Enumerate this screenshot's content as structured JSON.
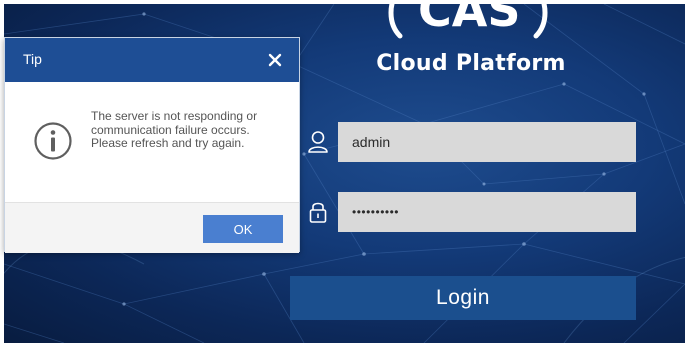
{
  "brand": {
    "logo_text": "CAS",
    "platform_name": "Cloud Platform"
  },
  "login_form": {
    "username_icon": "user-icon",
    "username_value": "admin",
    "password_icon": "lock-icon",
    "password_value": "••••••••••",
    "login_label": "Login"
  },
  "dialog": {
    "title": "Tip",
    "close_icon": "close-icon",
    "info_icon": "info-icon",
    "message": "The server is not responding or communication failure occurs. Please refresh and try again.",
    "ok_label": "OK"
  },
  "colors": {
    "background": "#133a78",
    "dialog_header": "#1e4e95",
    "ok_button": "#4a7fd0",
    "login_button": "#1b4f8e",
    "field_background": "#d9d9d9"
  }
}
